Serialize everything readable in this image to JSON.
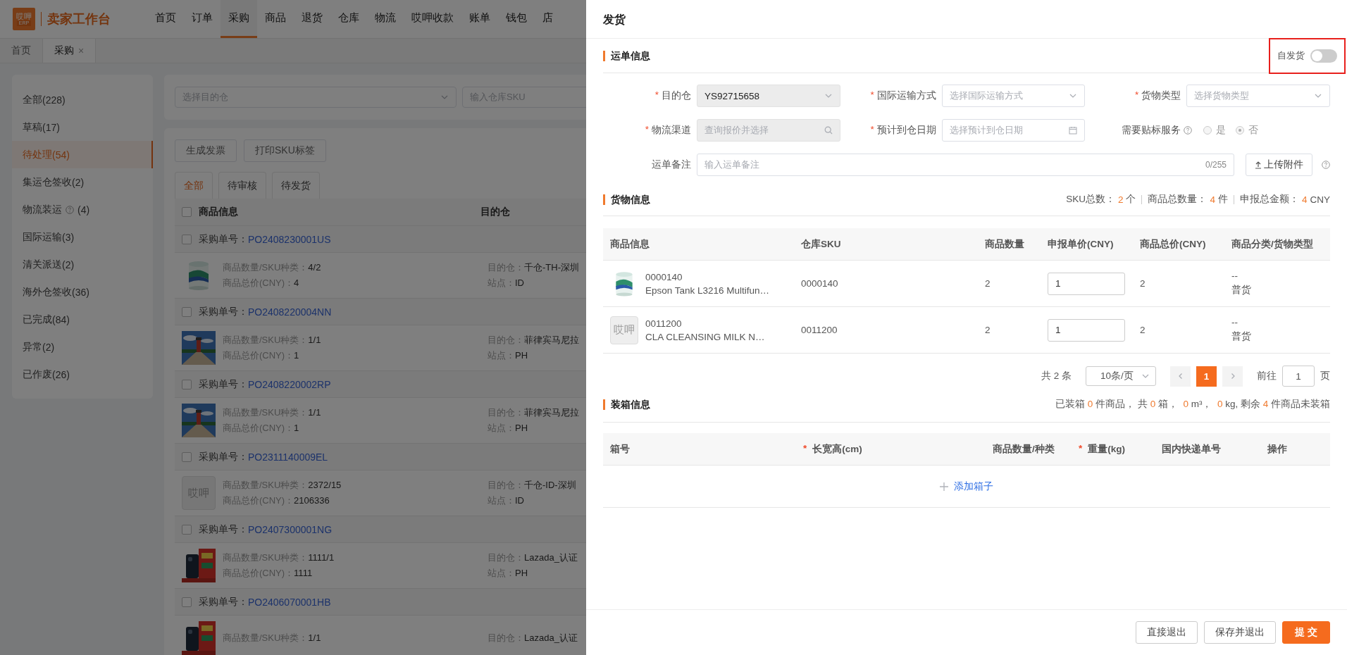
{
  "top_nav": {
    "logo_top": "哎呷",
    "logo_bottom": "ERP",
    "brand": "卖家工作台",
    "items": [
      {
        "label": "首页",
        "selected": false
      },
      {
        "label": "订单",
        "selected": false
      },
      {
        "label": "采购",
        "selected": true
      },
      {
        "label": "商品",
        "selected": false
      },
      {
        "label": "退货",
        "selected": false
      },
      {
        "label": "仓库",
        "selected": false
      },
      {
        "label": "物流",
        "selected": false
      },
      {
        "label": "哎呷收款",
        "selected": false
      },
      {
        "label": "账单",
        "selected": false
      },
      {
        "label": "钱包",
        "selected": false
      },
      {
        "label": "店",
        "selected": false
      }
    ]
  },
  "page_tabs": [
    {
      "label": "首页",
      "selected": false,
      "closable": false
    },
    {
      "label": "采购",
      "selected": true,
      "closable": true,
      "close": "×"
    }
  ],
  "sidebar": {
    "items": [
      {
        "name": "全部",
        "count": "(228)",
        "help": false,
        "selected": false
      },
      {
        "name": "草稿",
        "count": "(17)",
        "help": false,
        "selected": false
      },
      {
        "name": "待处理",
        "count": "(54)",
        "help": false,
        "selected": true
      },
      {
        "name": "集运仓签收",
        "count": "(2)",
        "help": false,
        "selected": false
      },
      {
        "name": "物流装运",
        "count": "(4)",
        "help": true,
        "selected": false
      },
      {
        "name": "国际运输",
        "count": "(3)",
        "help": false,
        "selected": false
      },
      {
        "name": "清关派送",
        "count": "(2)",
        "help": false,
        "selected": false
      },
      {
        "name": "海外仓签收",
        "count": "(36)",
        "help": false,
        "selected": false
      },
      {
        "name": "已完成",
        "count": "(84)",
        "help": false,
        "selected": false
      },
      {
        "name": "异常",
        "count": "(2)",
        "help": false,
        "selected": false
      },
      {
        "name": "已作废",
        "count": "(26)",
        "help": false,
        "selected": false
      }
    ]
  },
  "filters": [
    {
      "kind": "select",
      "placeholder": "选择目的仓"
    },
    {
      "kind": "text",
      "placeholder": "输入仓库SKU"
    }
  ],
  "action_buttons": [
    "生成发票",
    "打印SKU标签"
  ],
  "status_tabs": [
    {
      "label": "全部",
      "selected": true
    },
    {
      "label": "待审核",
      "selected": false
    },
    {
      "label": "待发货",
      "selected": false
    }
  ],
  "order_list": {
    "select_all": {
      "checked": false
    },
    "columns": [
      "商品信息",
      "目的仓"
    ],
    "orders": [
      {
        "checked": false,
        "po_label": "采购单号：",
        "po_number": "PO2408230001US",
        "qty_label": "商品数量/SKU种类：",
        "qty": "4/2",
        "price_label": "商品总价(CNY)：",
        "price": "4",
        "dest_label": "目的仓：",
        "dest": "千仓-TH-深圳",
        "site_label": "站点：",
        "site": "ID"
      },
      {
        "checked": false,
        "po_label": "采购单号：",
        "po_number": "PO2408220004NN",
        "qty_label": "商品数量/SKU种类：",
        "qty": "1/1",
        "price_label": "商品总价(CNY)：",
        "price": "1",
        "dest_label": "目的仓：",
        "dest": "菲律宾马尼拉",
        "site_label": "站点：",
        "site": "PH"
      },
      {
        "checked": false,
        "po_label": "采购单号：",
        "po_number": "PO2408220002RP",
        "qty_label": "商品数量/SKU种类：",
        "qty": "1/1",
        "price_label": "商品总价(CNY)：",
        "price": "1",
        "dest_label": "目的仓：",
        "dest": "菲律宾马尼拉",
        "site_label": "站点：",
        "site": "PH"
      },
      {
        "checked": false,
        "po_label": "采购单号：",
        "po_number": "PO2311140009EL",
        "thumb": {
          "kind": "placeholder",
          "text": "哎呷"
        },
        "qty_label": "商品数量/SKU种类：",
        "qty": "2372/15",
        "price_label": "商品总价(CNY)：",
        "price": "2106336",
        "dest_label": "目的仓：",
        "dest": "千仓-ID-深圳",
        "site_label": "站点：",
        "site": "ID"
      },
      {
        "checked": false,
        "po_label": "采购单号：",
        "po_number": "PO2407300001NG",
        "qty_label": "商品数量/SKU种类：",
        "qty": "1111/1",
        "price_label": "商品总价(CNY)：",
        "price": "1111",
        "dest_label": "目的仓：",
        "dest": "Lazada_认证",
        "site_label": "站点：",
        "site": "PH"
      },
      {
        "checked": false,
        "po_label": "采购单号：",
        "po_number": "PO2406070001HB",
        "qty_label": "商品数量/SKU种类：",
        "qty": "1/1",
        "dest_label": "目的仓：",
        "dest": "Lazada_认证"
      }
    ]
  },
  "drawer": {
    "title": "发货",
    "waybill": {
      "title": "运单信息",
      "self_ship": {
        "label": "自发货",
        "on": false,
        "highlighted": true
      },
      "fields": [
        {
          "kind": "select",
          "label": "目的仓",
          "required_mark": "*",
          "value": "YS92715658",
          "disabled": true
        },
        {
          "kind": "select",
          "label": "国际运输方式",
          "required_mark": "*",
          "placeholder": "选择国际运输方式",
          "disabled": false
        },
        {
          "kind": "select",
          "label": "货物类型",
          "required_mark": "*",
          "placeholder": "选择货物类型",
          "disabled": false
        },
        {
          "kind": "search",
          "label": "物流渠道",
          "required_mark": "*",
          "placeholder": "查询报价并选择",
          "disabled": true
        },
        {
          "kind": "date",
          "label": "预计到仓日期",
          "required_mark": "*",
          "placeholder": "选择预计到仓日期",
          "disabled": false
        },
        {
          "kind": "radio",
          "label": "需要贴标服务",
          "help": true,
          "options": [
            {
              "label": "是",
              "selected": false
            },
            {
              "label": "否",
              "selected": true
            }
          ]
        }
      ],
      "remark": {
        "label": "运单备注",
        "placeholder": "输入运单备注",
        "counter": "0/255",
        "upload": "上传附件"
      }
    },
    "goods": {
      "title": "货物信息",
      "summary": [
        {
          "label": "SKU总数：",
          "value": "2",
          "unit": "个"
        },
        {
          "label": "商品总数量：",
          "value": "4",
          "unit": "件"
        },
        {
          "label": "申报总金额：",
          "value": "4",
          "unit": "CNY"
        }
      ],
      "columns": [
        "商品信息",
        "仓库SKU",
        "商品数量",
        "申报单价(CNY)",
        "商品总价(CNY)",
        "商品分类/货物类型"
      ],
      "rows": [
        {
          "code": "0000140",
          "name": "Epson Tank L3216 Multifun…",
          "sku": "0000140",
          "qty": "2",
          "unit_price": "1",
          "total": "2",
          "category": "--",
          "cargo_type": "普货"
        },
        {
          "thumb": {
            "kind": "placeholder",
            "text": "哎呷"
          },
          "code": "0011200",
          "name": "CLA CLEANSING MILK N…",
          "sku": "0011200",
          "qty": "2",
          "unit_price": "1",
          "total": "2",
          "category": "--",
          "cargo_type": "普货"
        }
      ],
      "pagination": {
        "total": "共 2 条",
        "page_size": "10条/页",
        "pages": [
          {
            "label": "1",
            "selected": true
          }
        ],
        "goto_label": "前往",
        "goto_value": "1",
        "page_unit": "页"
      }
    },
    "boxes": {
      "title": "装箱信息",
      "summary": [
        {
          "text": "已装箱 ",
          "kind": "plain"
        },
        {
          "text": "0",
          "kind": "number"
        },
        {
          "text": " 件商品， 共 ",
          "kind": "plain"
        },
        {
          "text": "0",
          "kind": "number"
        },
        {
          "text": " 箱，  ",
          "kind": "plain"
        },
        {
          "text": "0",
          "kind": "number"
        },
        {
          "text": " m³，  ",
          "kind": "plain"
        },
        {
          "text": "0",
          "kind": "number"
        },
        {
          "text": " kg, 剩余 ",
          "kind": "plain"
        },
        {
          "text": "4",
          "kind": "number"
        },
        {
          "text": " 件商品未装箱",
          "kind": "plain"
        }
      ],
      "columns": [
        {
          "label": "箱号"
        },
        {
          "label": "长宽高(cm)",
          "required_mark": "*"
        },
        {
          "label": "商品数量/种类"
        },
        {
          "label": "重量(kg)",
          "required_mark": "*"
        },
        {
          "label": "国内快递单号"
        },
        {
          "label": "操作"
        }
      ],
      "add_box": "添加箱子"
    },
    "footer_buttons": [
      {
        "label": "直接退出",
        "kind": "default"
      },
      {
        "label": "保存并退出",
        "kind": "default"
      },
      {
        "label": "提 交",
        "kind": "primary"
      }
    ]
  }
}
